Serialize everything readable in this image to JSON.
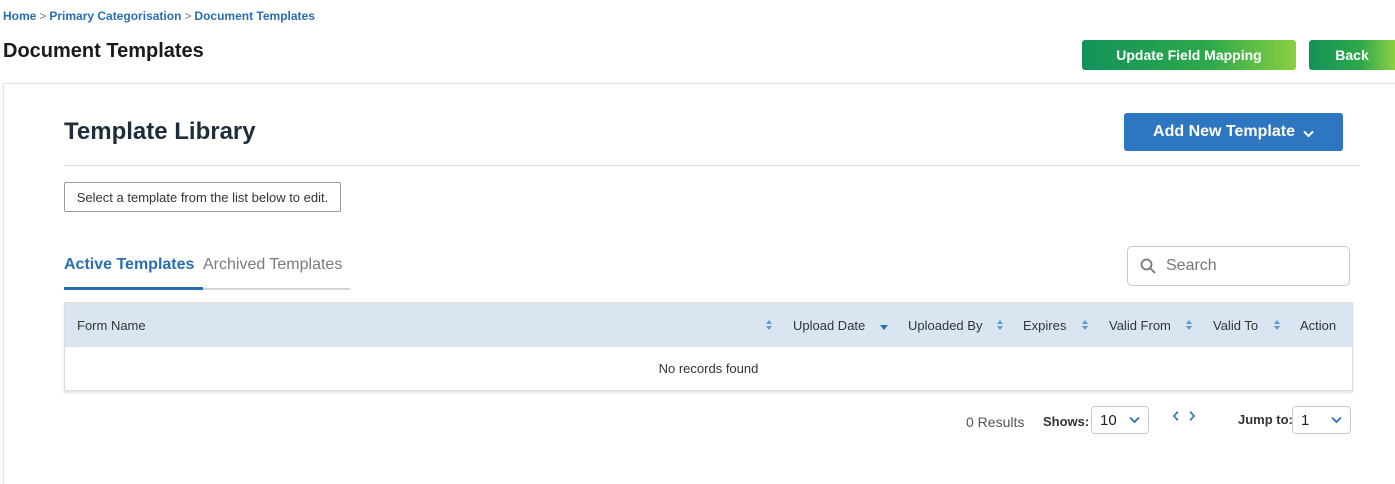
{
  "breadcrumb": {
    "items": [
      "Home",
      "Primary Categorisation",
      "Document Templates"
    ],
    "separator": ">"
  },
  "header": {
    "title": "Document Templates",
    "update_mapping_label": "Update Field Mapping",
    "back_label": "Back"
  },
  "library": {
    "title": "Template Library",
    "add_label": "Add New Template",
    "hint": "Select a template from the list below to edit."
  },
  "tabs": {
    "active": "Active Templates",
    "archived": "Archived Templates"
  },
  "search": {
    "placeholder": "Search"
  },
  "table": {
    "columns": [
      "Form Name",
      "Upload Date",
      "Uploaded By",
      "Expires",
      "Valid From",
      "Valid To",
      "Action"
    ],
    "empty_message": "No records found"
  },
  "pagination": {
    "results": "0 Results",
    "shows_label": "Shows:",
    "page_size": "10",
    "jump_label": "Jump to:",
    "jump_page": "1"
  },
  "colors": {
    "link_blue": "#2a6db5",
    "primary_button": "#2e76bf",
    "green_start": "#12925a",
    "green_end": "#8bd042",
    "table_header_bg": "#d9e6f2",
    "sort_icon": "#5b9bd5"
  }
}
